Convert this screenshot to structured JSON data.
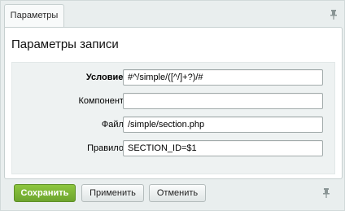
{
  "tab": {
    "label": "Параметры"
  },
  "panel": {
    "title": "Параметры записи"
  },
  "form": {
    "condition": {
      "label": "Условие:",
      "value": "#^/simple/([^/]+?)/#"
    },
    "component": {
      "label": "Компонент:",
      "value": ""
    },
    "file": {
      "label": "Файл:",
      "value": "/simple/section.php"
    },
    "rule": {
      "label": "Правило:",
      "value": "SECTION_ID=$1"
    }
  },
  "buttons": {
    "save": "Сохранить",
    "apply": "Применить",
    "cancel": "Отменить"
  },
  "icons": {
    "pin_top": "pin-icon",
    "pin_bottom": "pin-icon"
  }
}
